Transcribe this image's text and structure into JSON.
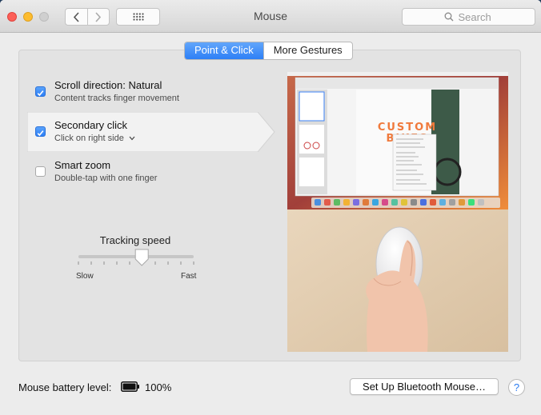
{
  "window": {
    "title": "Mouse",
    "search_placeholder": "Search"
  },
  "tabs": [
    {
      "label": "Point & Click",
      "active": true
    },
    {
      "label": "More Gestures",
      "active": false
    }
  ],
  "options": [
    {
      "title": "Scroll direction: Natural",
      "subtitle": "Content tracks finger movement",
      "checked": true
    },
    {
      "title": "Secondary click",
      "subtitle": "Click on right side",
      "checked": true,
      "selected": true,
      "has_dropdown": true
    },
    {
      "title": "Smart zoom",
      "subtitle": "Double-tap with one finger",
      "checked": false
    }
  ],
  "tracking": {
    "label": "Tracking speed",
    "min_label": "Slow",
    "max_label": "Fast",
    "level": 0.55,
    "tick_count": 10
  },
  "preview": {
    "poster_text_line1": "CUSTOM",
    "poster_text_line2": "BIKES"
  },
  "footer": {
    "battery_label": "Mouse battery level:",
    "battery_percent": "100%",
    "battery_level": 1.0,
    "setup_button": "Set Up Bluetooth Mouse…",
    "help_label": "?"
  },
  "colors": {
    "accent": "#2d7ff6",
    "window_bg": "#ececec",
    "panel_bg": "#e3e3e3",
    "poster_orange": "#f07a3c"
  }
}
